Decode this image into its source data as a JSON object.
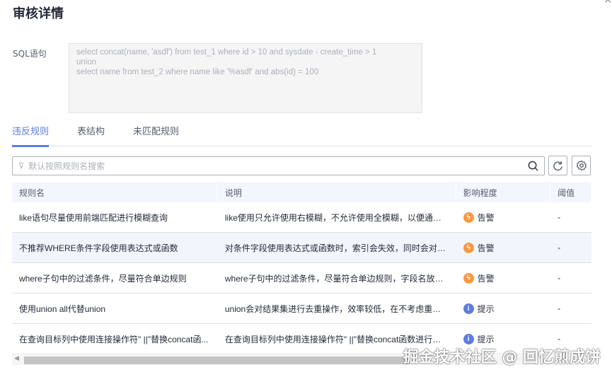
{
  "title": "审核详情",
  "sql": {
    "label": "SQL语句",
    "value": "select concat(name, 'asdf') from test_1 where id > 10 and sysdate - create_time > 1\nunion\nselect name from test_2 where name like '%asdf' and abs(id) = 100"
  },
  "tabs": [
    {
      "label": "违反规则"
    },
    {
      "label": "表结构"
    },
    {
      "label": "未匹配规则"
    }
  ],
  "search": {
    "placeholder": "默认按照规则名搜索"
  },
  "table": {
    "headers": [
      "规则名",
      "说明",
      "影响程度",
      "阈值"
    ],
    "rows": [
      {
        "name": "like语句尽量使用前端匹配进行模糊查询",
        "desc": "like使用只允许使用右模糊，不允许使用全模糊，以便通过索...",
        "level": "告警",
        "type": "warn",
        "threshold": "-"
      },
      {
        "name": "不推荐WHERE条件字段使用表达式或函数",
        "desc": "对条件字段使用表达式或函数时，索引会失效，同时会对每...",
        "level": "告警",
        "type": "warn",
        "threshold": "-"
      },
      {
        "name": "where子句中的过滤条件，尽量符合单边规则",
        "desc": "where子句中的过滤条件，尽量符合单边规则，字段名放在比...",
        "level": "告警",
        "type": "warn",
        "threshold": "-"
      },
      {
        "name": "使用union all代替union",
        "desc": "union会对结果集进行去重操作，效率较低，在不考虑重复值...",
        "level": "提示",
        "type": "info",
        "threshold": "-"
      },
      {
        "name": "在查询目标列中使用连接操作符\" ||\"替换concat函...",
        "desc": "在查询目标列中使用连接操作符\" ||\"替换concat函数进行字符...",
        "level": "提示",
        "type": "info",
        "threshold": "-"
      }
    ]
  },
  "colors": {
    "accent": "#5e7ce0",
    "warn": "#fa9841",
    "info": "#5e7ce0"
  },
  "watermark": "掘金技术社区 @ 回忆煎成饼"
}
